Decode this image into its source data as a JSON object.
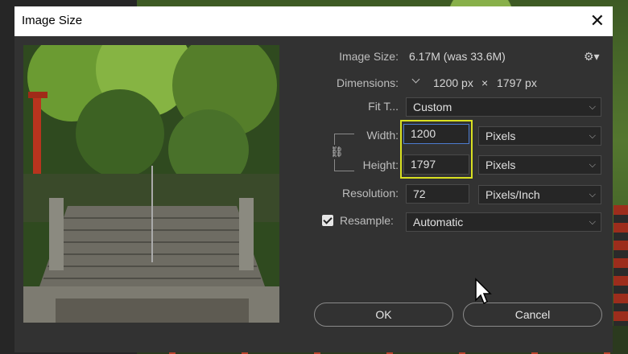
{
  "dialog": {
    "title": "Image Size"
  },
  "info": {
    "image_size_label": "Image Size:",
    "image_size_value": "6.17M (was 33.6M)",
    "dimensions_label": "Dimensions:",
    "dimensions_width": "1200 px",
    "dimensions_sep": "×",
    "dimensions_height": "1797 px"
  },
  "fit": {
    "label": "Fit T...",
    "value": "Custom"
  },
  "width": {
    "label": "Width:",
    "value": "1200",
    "unit": "Pixels"
  },
  "height": {
    "label": "Height:",
    "value": "1797",
    "unit": "Pixels"
  },
  "resolution": {
    "label": "Resolution:",
    "value": "72",
    "unit": "Pixels/Inch"
  },
  "resample": {
    "label": "Resample:",
    "value": "Automatic",
    "checked": true
  },
  "buttons": {
    "ok": "OK",
    "cancel": "Cancel"
  },
  "icons": {
    "close": "close-icon",
    "gear": "gear-icon",
    "link": "link-chain-icon",
    "chevron": "chevron-down-icon"
  },
  "colors": {
    "highlight": "#d9e021",
    "dialog_bg": "#323232",
    "field_bg": "#262626",
    "active_border": "#4d7cd0"
  }
}
